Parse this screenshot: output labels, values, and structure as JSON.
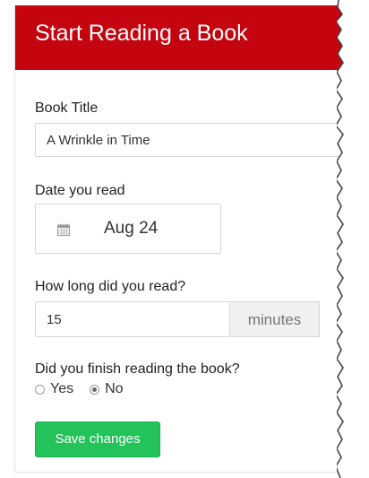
{
  "header": {
    "title": "Start Reading a Book"
  },
  "form": {
    "book_title": {
      "label": "Book Title",
      "value": "A Wrinkle in Time"
    },
    "date_read": {
      "label": "Date you read",
      "value": "Aug 24",
      "icon": "calendar-icon"
    },
    "duration": {
      "label": "How long did you read?",
      "value": "15",
      "unit": "minutes"
    },
    "finished": {
      "label": "Did you finish reading the book?",
      "options": [
        {
          "label": "Yes",
          "checked": false
        },
        {
          "label": "No",
          "checked": true
        }
      ]
    },
    "save_label": "Save changes"
  },
  "colors": {
    "header_bg": "#c4040e",
    "save_bg": "#22c45a"
  }
}
